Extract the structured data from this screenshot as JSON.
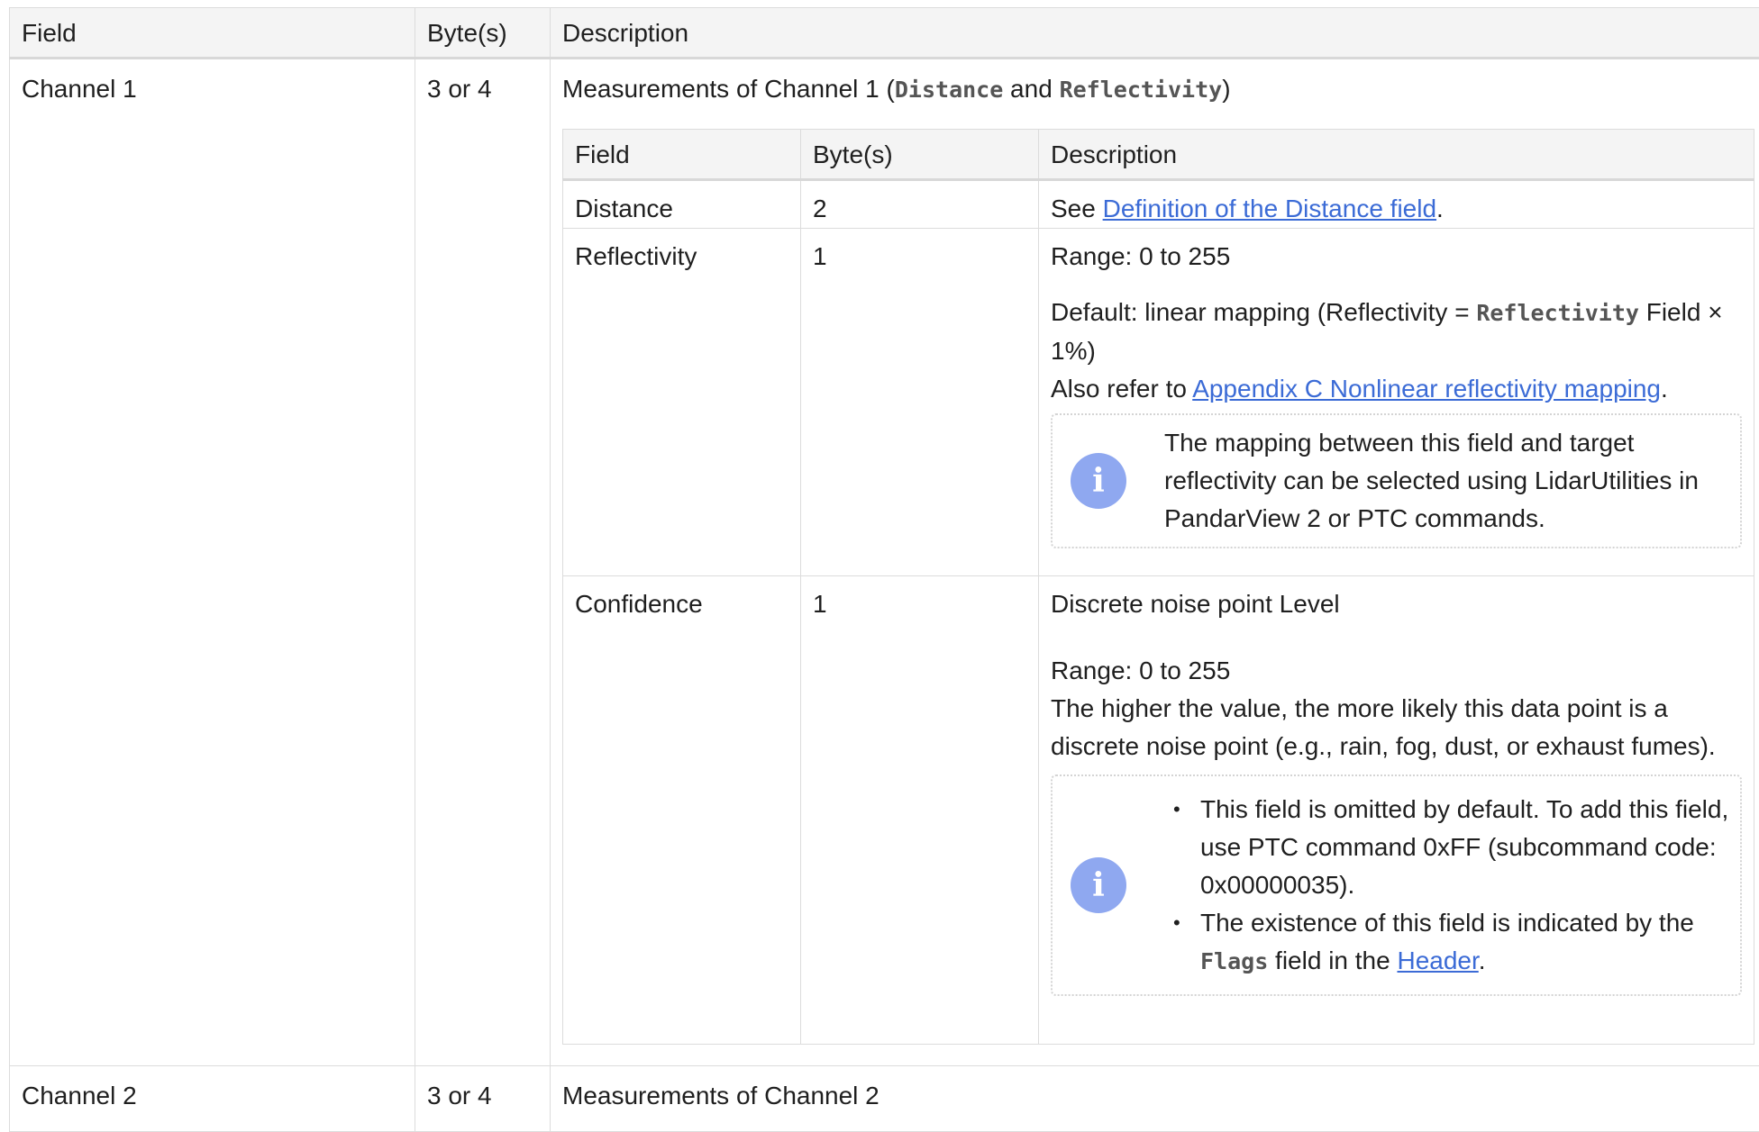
{
  "outer_headers": [
    "Field",
    "Byte(s)",
    "Description"
  ],
  "channel1": {
    "field": "Channel 1",
    "bytes": "3 or 4",
    "desc_prefix": "Measurements of Channel 1 (",
    "desc_code1": "Distance",
    "desc_and": " and ",
    "desc_code2": "Reflectivity",
    "desc_suffix": ")"
  },
  "inner_headers": [
    "Field",
    "Byte(s)",
    "Description"
  ],
  "distance": {
    "field": "Distance",
    "bytes": "2",
    "desc_prefix": "See ",
    "desc_link": "Definition of the Distance field",
    "desc_suffix": "."
  },
  "reflectivity": {
    "field": "Reflectivity",
    "bytes": "1",
    "range": "Range: 0 to 255",
    "default_prefix": "Default: linear mapping (Reflectivity = ",
    "default_code": "Reflectivity",
    "default_suffix": " Field × 1%)",
    "refer_prefix": "Also refer to ",
    "refer_link": "Appendix C Nonlinear reflectivity mapping",
    "refer_suffix": ".",
    "note_icon": "info-icon",
    "note": "The mapping between this field and target reflectivity can be selected using LidarUtilities in PandarView 2 or PTC commands."
  },
  "confidence": {
    "field": "Confidence",
    "bytes": "1",
    "line1": "Discrete noise point Level",
    "range": "Range: 0 to 255",
    "line2": "The higher the value, the more likely this data point is a discrete noise point (e.g., rain, fog, dust, or exhaust fumes).",
    "note_icon": "info-icon",
    "bullet1": "This field is omitted by default. To add this field, use PTC command 0xFF (subcommand code: 0x00000035).",
    "bullet2_prefix": "The existence of this field is indicated by the ",
    "bullet2_code": "Flags",
    "bullet2_mid": " field in the ",
    "bullet2_link": "Header",
    "bullet2_suffix": "."
  },
  "channel2": {
    "field": "Channel 2",
    "bytes": "3 or 4",
    "desc": "Measurements of Channel 2"
  }
}
